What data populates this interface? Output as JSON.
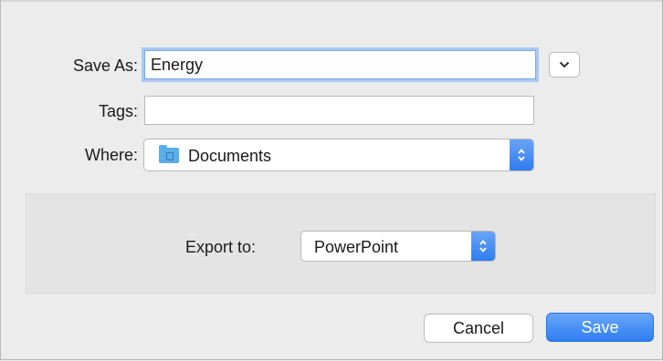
{
  "dialog": {
    "save_as_label": "Save As:",
    "save_as_value": "Energy",
    "tags_label": "Tags:",
    "tags_value": "",
    "where_label": "Where:",
    "where_value": "Documents",
    "where_icon": "folder-icon",
    "export_label": "Export to:",
    "export_value": "PowerPoint",
    "cancel_label": "Cancel",
    "save_label": "Save"
  },
  "colors": {
    "accent": "#2f7cf0",
    "background": "#ececec",
    "accessory_panel": "#e4e4e4",
    "folder": "#5aaee8"
  }
}
